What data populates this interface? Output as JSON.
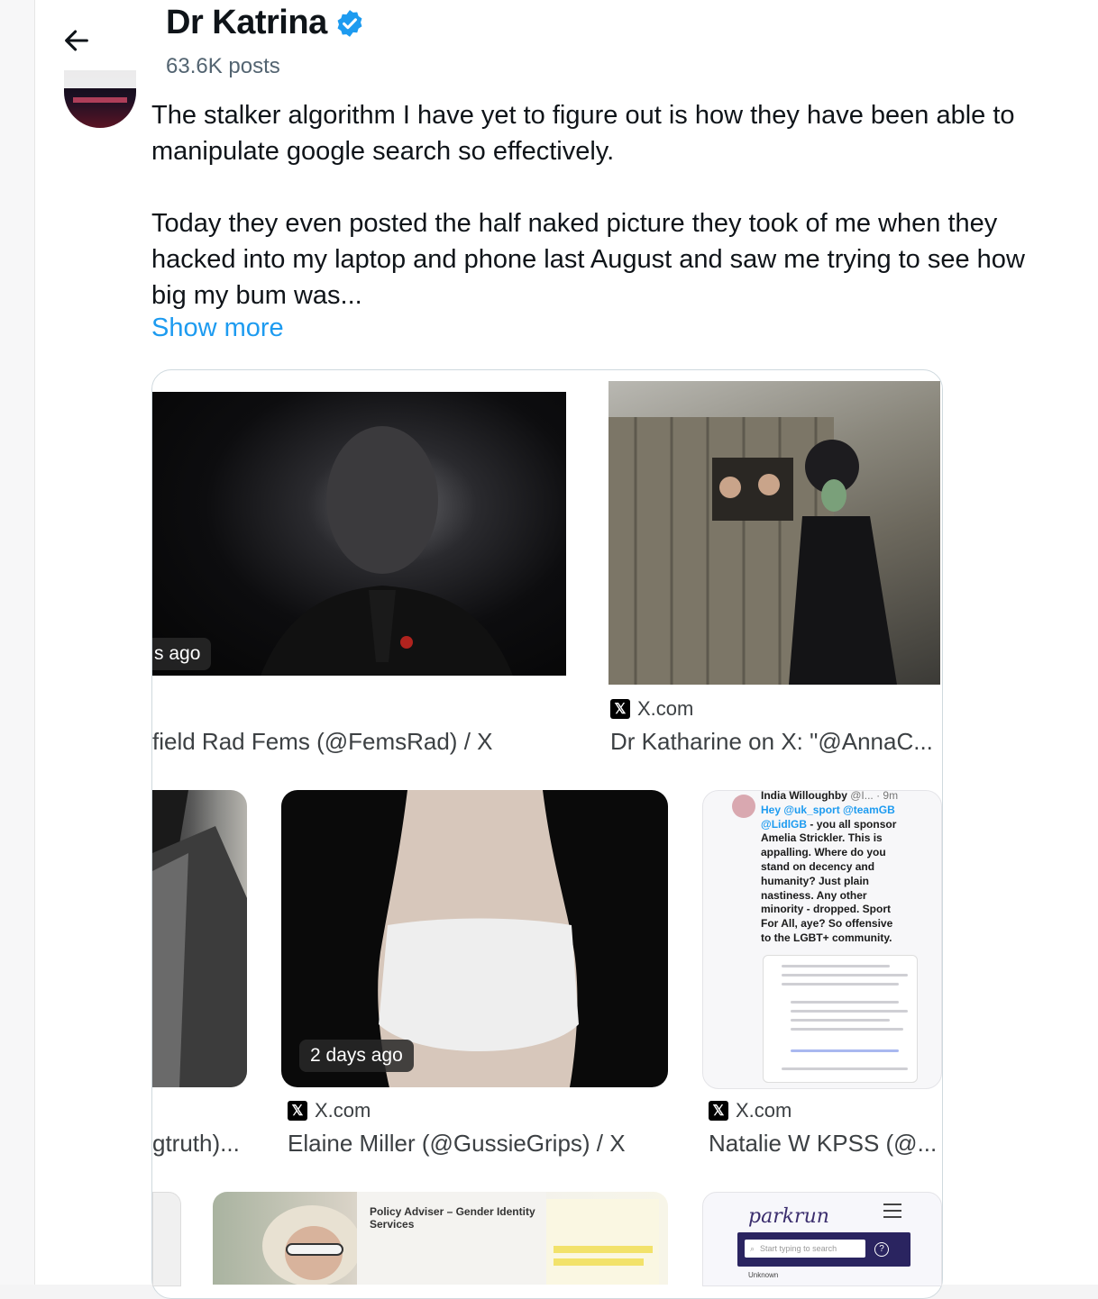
{
  "header": {
    "title": "Dr Katrina",
    "posts": "63.6K posts"
  },
  "tweet": {
    "para1": "The stalker algorithm I have yet to figure out is how they have been able to manipulate google search so effectively.",
    "para2_line1": "Today they even posted the half naked picture they took of me when they",
    "para2_line2": "hacked into my laptop and phone last August and saw me trying to see how",
    "para2_line3": "big my bum was...",
    "show_more": "Show more"
  },
  "results": {
    "r1": {
      "badge": "s ago",
      "caption": "field Rad Fems (@FemsRad) / X"
    },
    "r2": {
      "source": "X.com",
      "caption": "Dr Katharine on X: \"@AnnaC..."
    },
    "r3": {
      "caption": "gtruth)..."
    },
    "r4": {
      "badge": "2 days ago",
      "source": "X.com",
      "caption": "Elaine Miller (@GussieGrips) / X"
    },
    "r5": {
      "source": "X.com",
      "caption": "Natalie W KPSS (@...",
      "snippet_author": "India Willoughby",
      "snippet_handle": "@I... · 9m",
      "snippet_mentions": "Hey @uk_sport @teamGB @LidlGB",
      "snippet_body": "- you all sponsor Amelia Strickler. This is appalling. Where do you stand on decency and humanity? Just plain nastiness. Any other minority - dropped. Sport For All, aye? So offensive to the LGBT+ community."
    },
    "r6": {
      "doc_title": "Policy Adviser – Gender Identity Services"
    },
    "r7": {
      "logo": "parkrun",
      "search_placeholder": "Start typing to search",
      "unknown": "Unknown"
    }
  },
  "colors": {
    "accent": "#1d9bf0",
    "verified": "#1d9bf0"
  }
}
